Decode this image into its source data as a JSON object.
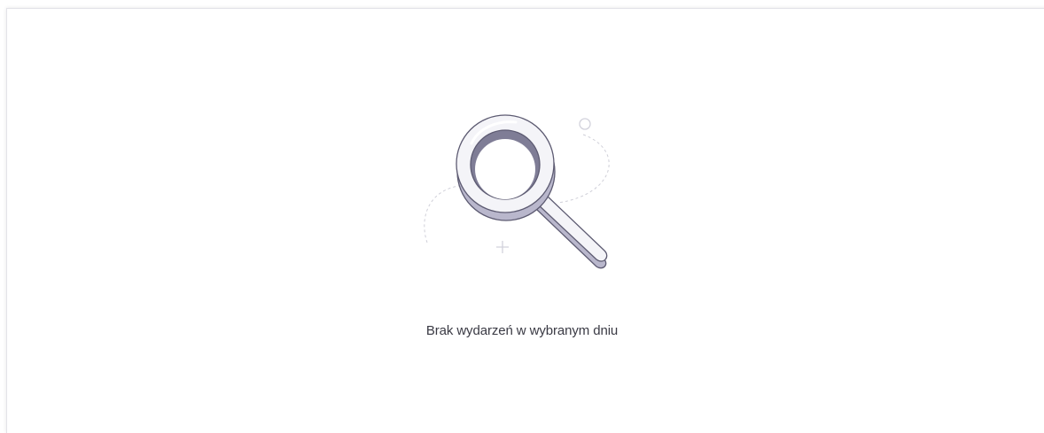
{
  "empty_state": {
    "icon": "search-icon",
    "message": "Brak wydarzeń w wybranym dniu"
  },
  "colors": {
    "text": "#3a3a44",
    "icon_fill": "#f4f4f8",
    "icon_shadow": "#b9b7cc",
    "icon_outline": "#5d5b72",
    "decor_line": "#cfcfd8"
  }
}
